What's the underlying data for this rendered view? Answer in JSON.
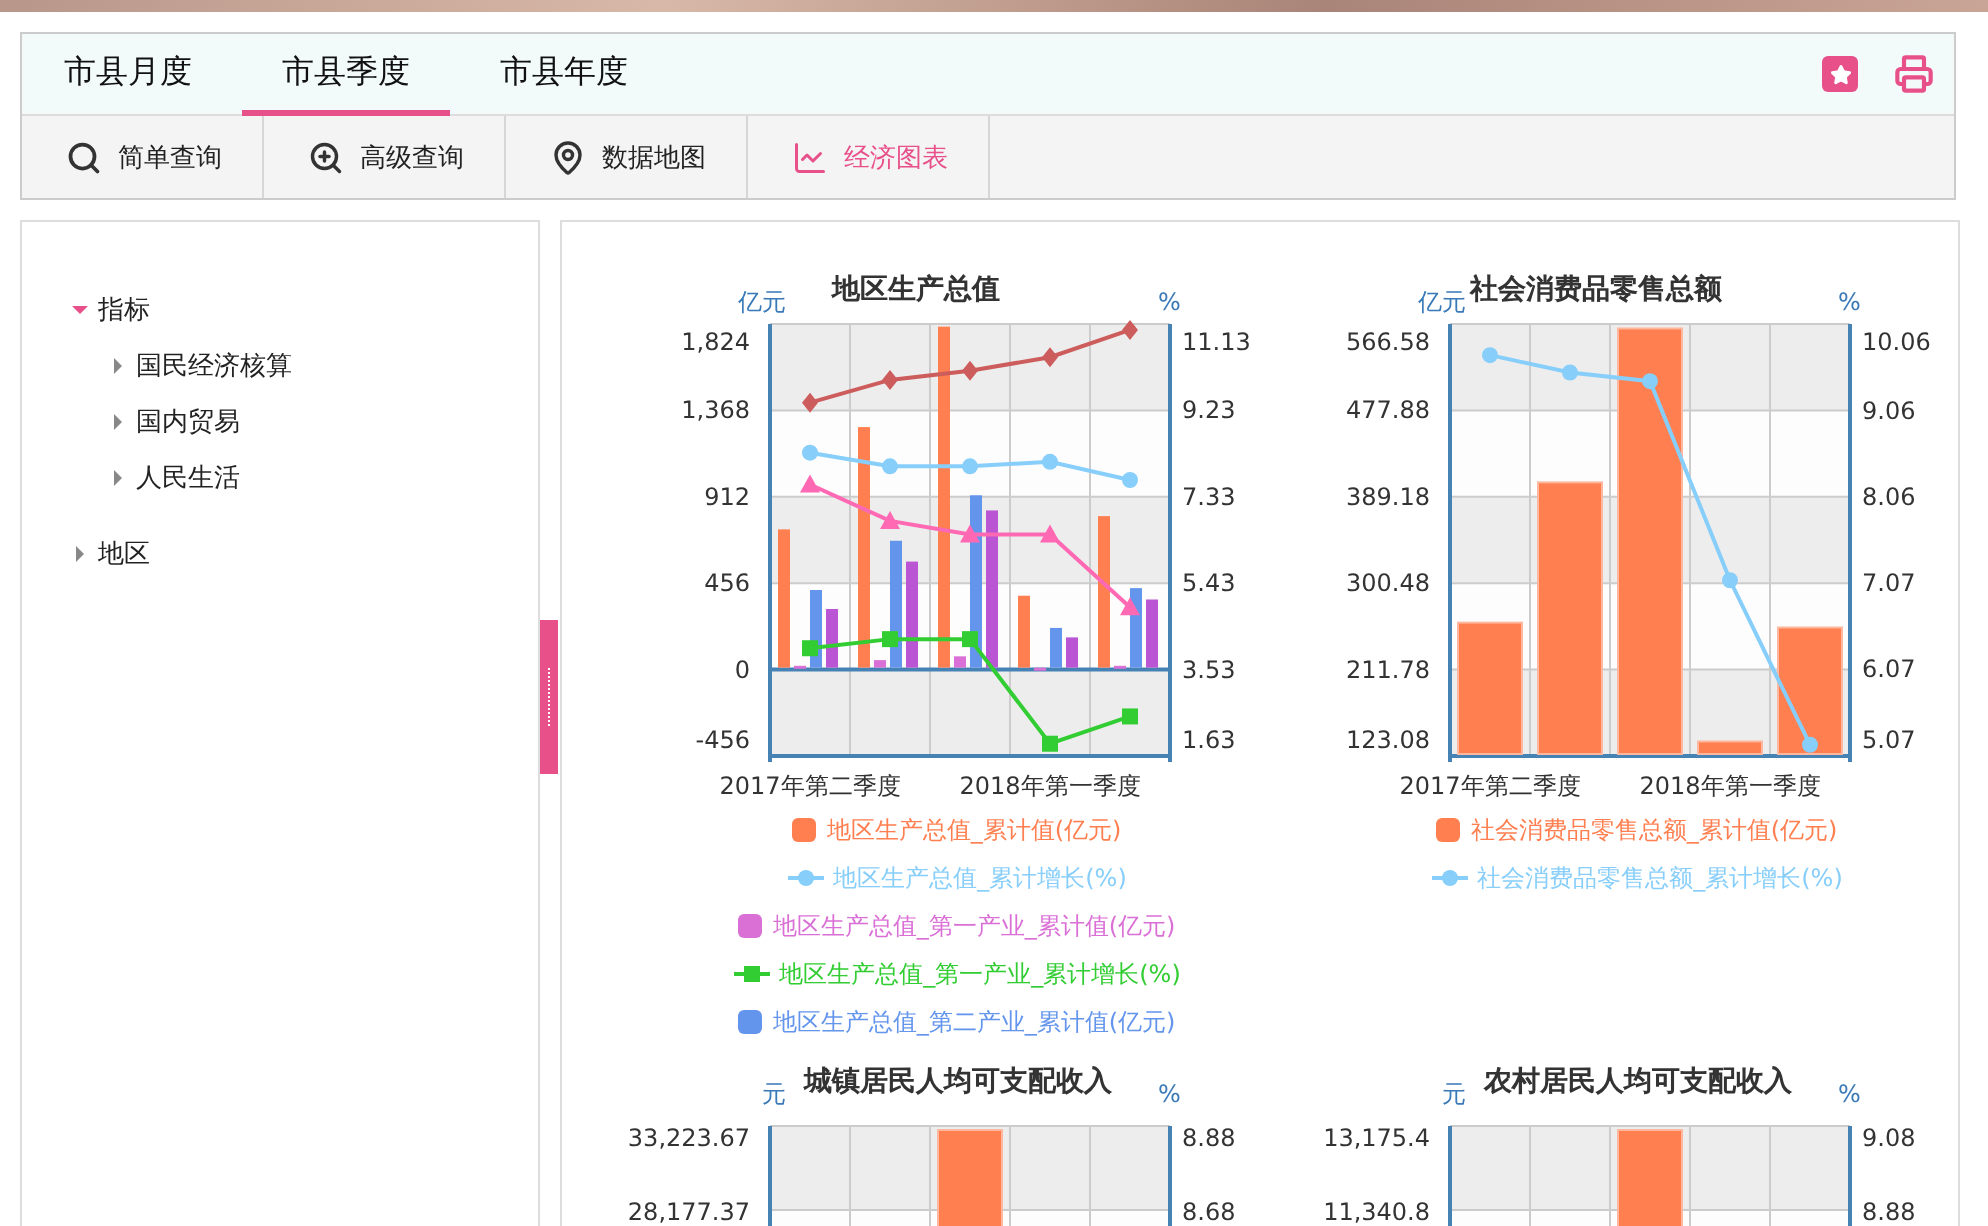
{
  "tabs": [
    {
      "label": "市县月度",
      "selected": false
    },
    {
      "label": "市县季度",
      "selected": true
    },
    {
      "label": "市县年度",
      "selected": false
    }
  ],
  "toolbar": [
    {
      "kind": "search",
      "label": "简单查询",
      "selected": false
    },
    {
      "kind": "advanced",
      "label": "高级查询",
      "selected": false
    },
    {
      "kind": "map",
      "label": "数据地图",
      "selected": false
    },
    {
      "kind": "chart",
      "label": "经济图表",
      "selected": true
    }
  ],
  "sidebar": {
    "items": [
      {
        "label": "指标",
        "expanded": true,
        "children": [
          {
            "label": "国民经济核算",
            "expanded": false
          },
          {
            "label": "国内贸易",
            "expanded": false
          },
          {
            "label": "人民生活",
            "expanded": false
          }
        ]
      },
      {
        "label": "地区",
        "expanded": false
      }
    ]
  },
  "charts": [
    {
      "left_unit": "亿元",
      "right_unit": "%",
      "chart_data": {
        "type": "bar",
        "title": "地区生产总值",
        "stacked": false,
        "grid": true,
        "ref_lines": [
          {
            "axis": "y",
            "value": 0,
            "color": "#4682b4"
          }
        ],
        "categories": [
          "2017年第二季度",
          null,
          null,
          "2018年第一季度",
          null
        ],
        "ylim": [
          -456,
          1824
        ],
        "yticks": [
          -456,
          0,
          456,
          912,
          {
            "value": 1368,
            "label": "1,368"
          },
          {
            "value": 1824,
            "label": "1,824"
          }
        ],
        "y2lim": [
          1.63,
          11.13
        ],
        "y2ticks": [
          1.63,
          3.53,
          5.43,
          7.33,
          9.23,
          11.13
        ],
        "series": [
          {
            "name": "地区生产总值_累计值(亿元)",
            "type": "bar",
            "color": "#ff7f50",
            "values": [
              740,
              1280,
              1810,
              390,
              810
            ]
          },
          {
            "name": "地区生产总值_累计增长(%)",
            "type": "line",
            "axis": "y2",
            "marker": "circle",
            "color": "#87cefa",
            "values": [
              8.3,
              8.0,
              8.0,
              8.1,
              7.7
            ]
          },
          {
            "name": "地区生产总值_第一产业_累计值(亿元)",
            "type": "bar",
            "color": "#da70d6",
            "values": [
              20,
              50,
              70,
              10,
              20
            ]
          },
          {
            "name": "地区生产总值_第一产业_累计增长(%)",
            "type": "line",
            "axis": "y2",
            "marker": "square",
            "color": "#32cd32",
            "values": [
              4.0,
              4.2,
              4.2,
              1.9,
              2.5
            ]
          },
          {
            "name": "地区生产总值_第二产业_累计值(亿元)",
            "type": "bar",
            "color": "#6495ed",
            "values": [
              420,
              680,
              920,
              220,
              430
            ]
          },
          {
            "type": "bar",
            "color": "#ba55d3",
            "values": [
              320,
              570,
              840,
              170,
              370
            ]
          },
          {
            "type": "line",
            "axis": "y2",
            "marker": "diamond",
            "color": "#cd5c5c",
            "values": [
              9.4,
              9.9,
              10.1,
              10.4,
              11.0
            ]
          },
          {
            "type": "line",
            "axis": "y2",
            "marker": "triangle",
            "color": "#ff69b4",
            "values": [
              7.6,
              6.8,
              6.5,
              6.5,
              4.9
            ]
          }
        ]
      }
    },
    {
      "left_unit": "亿元",
      "right_unit": "%",
      "chart_data": {
        "type": "bar",
        "title": "社会消费品零售总额",
        "stacked": false,
        "grid": true,
        "categories": [
          "2017年第二季度",
          null,
          null,
          "2018年第一季度",
          null
        ],
        "ylim": [
          123.08,
          566.58
        ],
        "yticks": [
          123.08,
          211.78,
          300.48,
          389.18,
          477.88,
          566.58
        ],
        "y2lim": [
          5.07,
          10.06
        ],
        "y2ticks": [
          5.07,
          6.07,
          7.07,
          8.06,
          9.06,
          10.06
        ],
        "series": [
          {
            "name": "社会消费品零售总额_累计值(亿元)",
            "type": "bar",
            "color": "#ff7f50",
            "values": [
              260,
              404,
              562,
              138,
              255
            ]
          },
          {
            "name": "社会消费品零售总额_累计增长(%)",
            "type": "line",
            "axis": "y2",
            "marker": "circle",
            "color": "#87cefa",
            "values": [
              9.7,
              9.5,
              9.4,
              7.1,
              5.2
            ]
          }
        ]
      }
    }
  ],
  "partial_charts": [
    {
      "title": "城镇居民人均可支配收入",
      "left_unit": "元",
      "right_unit": "%",
      "left_ticks": [
        "33,223.67",
        "28,177.37"
      ],
      "right_ticks": [
        "8.88",
        "8.68"
      ]
    },
    {
      "title": "农村居民人均可支配收入",
      "left_unit": "元",
      "right_unit": "%",
      "left_ticks": [
        "13,175.4",
        "11,340.8"
      ],
      "right_ticks": [
        "9.08",
        "8.88"
      ]
    }
  ]
}
